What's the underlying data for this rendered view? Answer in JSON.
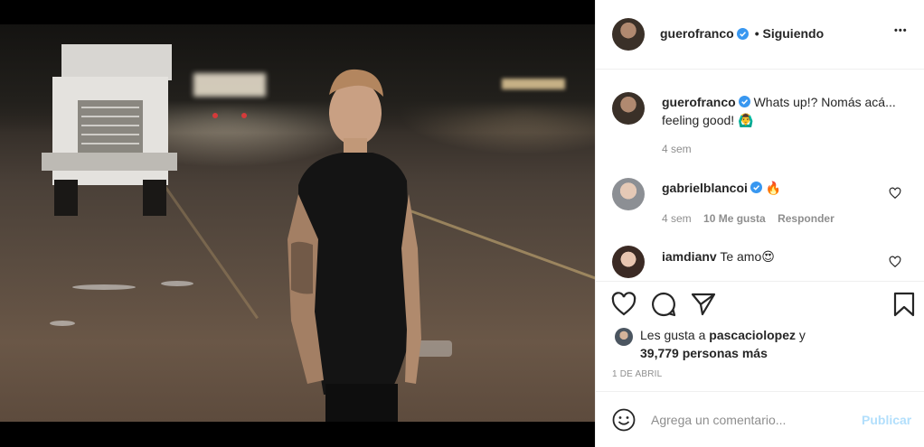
{
  "post": {
    "username": "guerofranco",
    "follow_state": "• Siguiendo",
    "more_label": "•••"
  },
  "caption": {
    "username": "guerofranco",
    "text": "Whats up!? Nomás acá... feeling good! 🙆‍♂️",
    "time": "4 sem"
  },
  "comments": [
    {
      "username": "gabrielblancoi",
      "text": "🔥",
      "time": "4 sem",
      "likes": "10 Me gusta",
      "reply": "Responder"
    },
    {
      "username": "iamdianv",
      "text": "Te amo😍"
    }
  ],
  "likes": {
    "prefix": "Les gusta a ",
    "user": "pascaciolopez",
    "suffix": " y",
    "others": "39,779 personas más"
  },
  "date": "1 DE ABRIL",
  "composer": {
    "placeholder": "Agrega un comentario...",
    "publish": "Publicar"
  },
  "icons": {
    "like": "heart-icon",
    "comment": "comment-icon",
    "share": "paper-plane-icon",
    "save": "bookmark-icon",
    "emoji": "emoji-icon",
    "verified": "verified-badge-icon",
    "more": "more-options-icon"
  },
  "colors": {
    "verified": "#3897f0",
    "publish_disabled": "#b2dffc",
    "muted": "#8e8e8e",
    "text": "#262626"
  }
}
